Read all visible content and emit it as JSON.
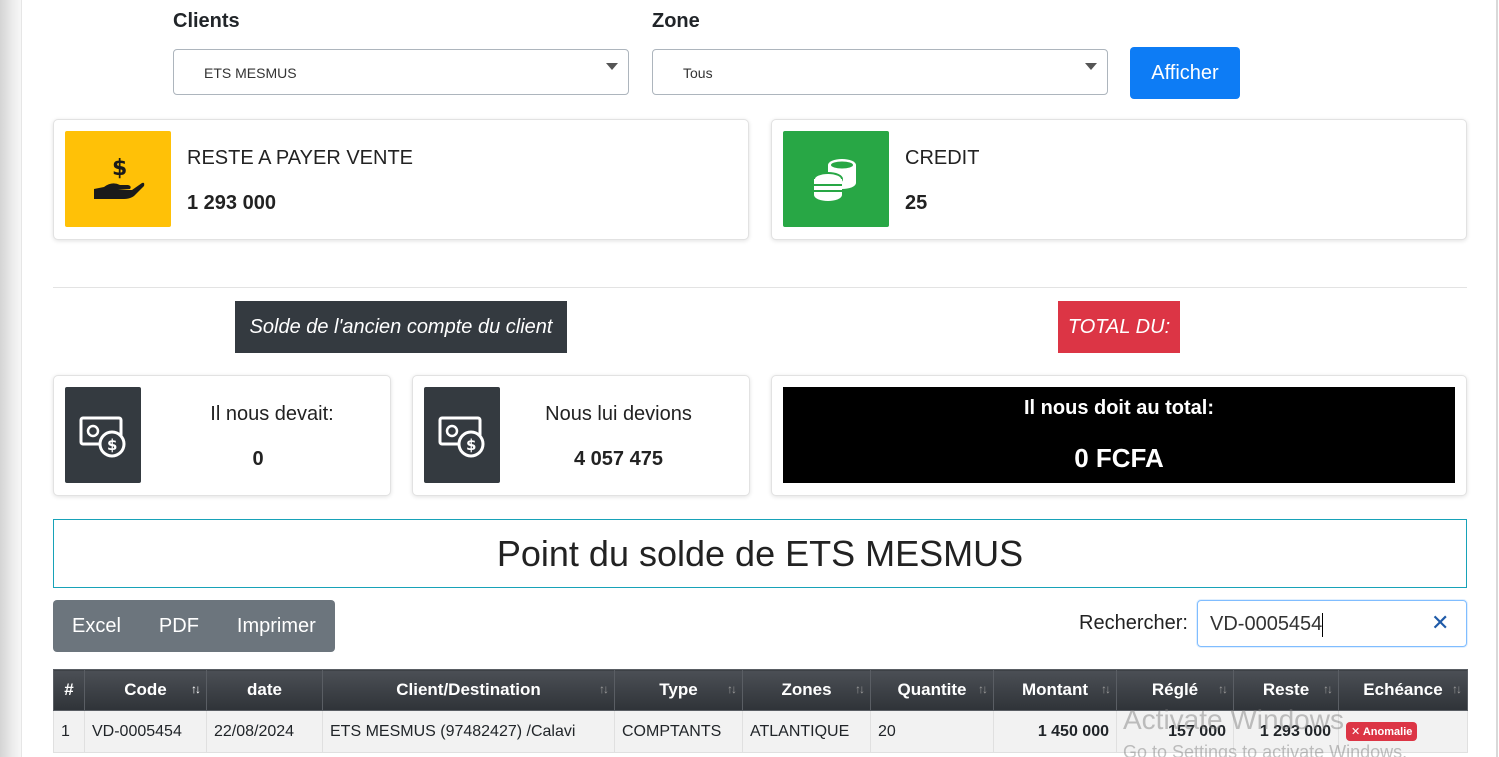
{
  "filters": {
    "clients_label": "Clients",
    "clients_value": "ETS MESMUS",
    "zone_label": "Zone",
    "zone_value": "Tous",
    "afficher_label": "Afficher"
  },
  "cards": {
    "reste": {
      "title": "RESTE A PAYER VENTE",
      "value": "1 293 000",
      "icon": "hand-dollar-icon",
      "color": "#ffc107"
    },
    "credit": {
      "title": "CREDIT",
      "value": "25",
      "icon": "coins-icon",
      "color": "#28a745"
    }
  },
  "labels": {
    "ancien": "Solde de l'ancien compte du client",
    "total_du": "TOTAL DU:"
  },
  "balances": {
    "devait": {
      "title": "Il nous devait:",
      "value": "0",
      "icon": "money-bill-icon"
    },
    "devions": {
      "title": "Nous lui devions",
      "value": "4 057 475",
      "icon": "money-bill-icon"
    },
    "total": {
      "title": "Il nous doit au total:",
      "value": "0 FCFA"
    }
  },
  "solde_title": "Point du solde de ETS MESMUS",
  "export": {
    "excel": "Excel",
    "pdf": "PDF",
    "print": "Imprimer"
  },
  "search": {
    "label": "Rechercher:",
    "value": "VD-0005454",
    "clear": "✕"
  },
  "table": {
    "headers": [
      "#",
      "Code",
      "date",
      "Client/Destination",
      "Type",
      "Zones",
      "Quantite",
      "Montant",
      "Réglé",
      "Reste",
      "Echéance"
    ],
    "row": [
      "1",
      "VD-0005454",
      "22/08/2024",
      "ETS MESMUS (97482427) /Calavi",
      "COMPTANTS",
      "ATLANTIQUE",
      "20",
      "1 450 000",
      "157 000",
      "1 293 000"
    ],
    "badge": "✕ Anomalie"
  },
  "watermark": {
    "line1": "Activate Windows",
    "line2": "Go to Settings to activate Windows."
  }
}
